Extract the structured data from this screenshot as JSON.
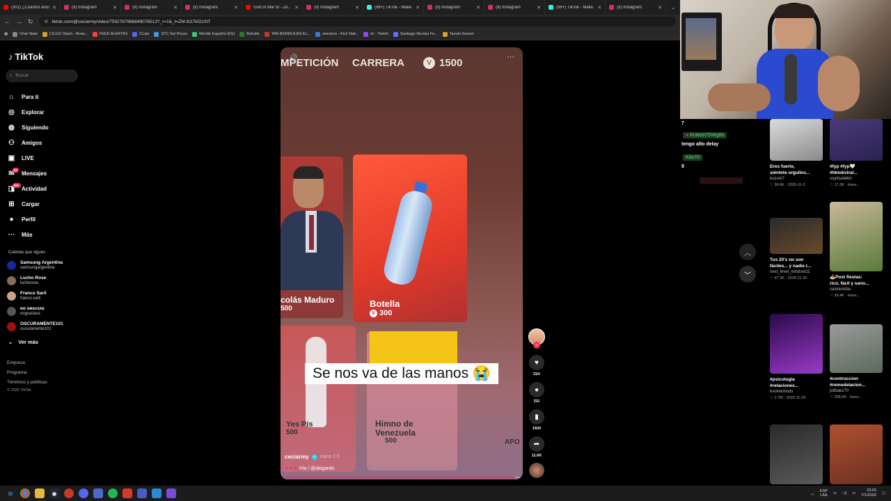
{
  "browser": {
    "tabs": [
      {
        "title": "(302) ¿Cuántos años...",
        "color": "#ff0000"
      },
      {
        "title": "(9) Instagram",
        "color": "#d62976"
      },
      {
        "title": "(9) Instagram",
        "color": "#d62976"
      },
      {
        "title": "(9) Instagram",
        "color": "#d62976"
      },
      {
        "title": "God of War III - Ze...",
        "color": "#ff0000"
      },
      {
        "title": "(9) Instagram",
        "color": "#d62976"
      },
      {
        "title": "(99+) TikTok - Make...",
        "color": "#25f4ee"
      },
      {
        "title": "(9) Instagram",
        "color": "#d62976"
      },
      {
        "title": "(9) Instagram",
        "color": "#d62976"
      },
      {
        "title": "(99+) TikTok - Make...",
        "color": "#25f4ee"
      },
      {
        "title": "(9) Instagram",
        "color": "#d62976"
      }
    ],
    "url": "tiktok.com/@ceciarmy/video/7592767966849076513?_r=1&_t=ZM-92t7kf2zXtT",
    "bookmarks": [
      "Chat Stats",
      "CS:GO Stash - Brow...",
      "FEED ALERTAS",
      "CLips",
      "STC Set Prices",
      "Wordle Español (ES)",
      "Boludle",
      "TAN BIONICA EN EL...",
      "sionaron - Kick Stat...",
      "trr - Twitch",
      "Santiago Nicolas Fe...",
      "Tanuki Sunset"
    ]
  },
  "sidebar": {
    "logo": "TikTok",
    "search_placeholder": "Buscar",
    "items": [
      {
        "label": "Para ti",
        "icon": "home-icon",
        "glyph": "⌂"
      },
      {
        "label": "Explorar",
        "icon": "compass-icon",
        "glyph": "◎"
      },
      {
        "label": "Siguiendo",
        "icon": "following-icon",
        "glyph": "◍"
      },
      {
        "label": "Amigos",
        "icon": "friends-icon",
        "glyph": "⚇"
      },
      {
        "label": "LIVE",
        "icon": "live-icon",
        "glyph": "▣"
      },
      {
        "label": "Mensajes",
        "icon": "messages-icon",
        "glyph": "✉",
        "badge": "57"
      },
      {
        "label": "Actividad",
        "icon": "activity-icon",
        "glyph": "◨",
        "badge": "99+"
      },
      {
        "label": "Cargar",
        "icon": "upload-icon",
        "glyph": "⊞"
      },
      {
        "label": "Perfil",
        "icon": "profile-icon",
        "glyph": "●"
      },
      {
        "label": "Más",
        "icon": "more-icon",
        "glyph": "···"
      }
    ],
    "following_header": "Cuentas que sigues",
    "following": [
      {
        "name": "Samsung Argentina",
        "user": "samsungargentina",
        "color": "#1428a0"
      },
      {
        "name": "Lucho Rose",
        "user": "luchorose",
        "color": "#8a6a5a"
      },
      {
        "name": "Franco Sarli",
        "user": "franco.sarli",
        "color": "#c9a48b"
      },
      {
        "name": "ɴᴏ ɢʀᴀᴄɪᴀꜱ",
        "user": "nograciasz",
        "color": "#555"
      },
      {
        "name": "OSCURAMENTE101",
        "user": "oscuramente101",
        "color": "#a01010"
      }
    ],
    "see_more": "Ver más",
    "footer": [
      "Empresa",
      "Programa",
      "Términos y políticas"
    ],
    "copyright": "© 2026 TikTok"
  },
  "video": {
    "top_labels": [
      "MPETICIÓN",
      "CARRERA",
      "1500"
    ],
    "cards": [
      {
        "title": "colás Maduro",
        "price": "500"
      },
      {
        "title": "Botella",
        "price": "300"
      },
      {
        "title": "Yes Pis",
        "price": "500"
      },
      {
        "title": "Himno de Venezuela",
        "price": "500"
      },
      {
        "title": "APO"
      }
    ],
    "subtitle": "Se nos va de las manos 😭",
    "author": "ceciarmy",
    "time": "Hace 2 h",
    "sound": "Vía / @daigardo",
    "progress": 0.98
  },
  "actions": {
    "likes": "31K",
    "comments": "311",
    "saves": "1920",
    "shares": "11.6K"
  },
  "chat": {
    "lines": [
      {
        "text": "7"
      },
      {
        "tag": "KratosVSVegito"
      },
      {
        "text": "tengo alto delay"
      },
      {
        "tag": "Kito70"
      },
      {
        "text": "8"
      }
    ]
  },
  "grid": [
    {
      "title1": "Eres fuerte,",
      "title2": "siéntete orgullos...",
      "user": "kuzum7",
      "meta": "♡ 39.6K · 2025-11-3",
      "colors": [
        "#dcdcdc",
        "#8a8a8a"
      ]
    },
    {
      "title1": "#fyp #fyp🤍",
      "title2": "#tiktokviral...",
      "user": "soylizadebri",
      "meta": "♡ 17.3K · Hace...",
      "colors": [
        "#4a3a7a",
        "#2a2250"
      ]
    },
    {
      "title1": "Tus 20's no son",
      "title2": "fáciles... y nadie t...",
      "user": "next_level_mindset11",
      "meta": "♡ 47.2K · 2025-11-20",
      "colors": [
        "#2a2a2a",
        "#6a4a2a"
      ]
    },
    {
      "title1": "🍝Post fiestas:",
      "title2": "rico, fácil y sano...",
      "user": "casirecetas",
      "meta": "♡ 26.4K · Hace...",
      "colors": [
        "#c8b89a",
        "#5a7a3a"
      ]
    },
    {
      "title1": "#psicologia",
      "title2": "#relaciones...",
      "user": "evolveminds",
      "meta": "♡ 1.7M · 2025-11-29",
      "colors": [
        "#2a0a4a",
        "#9a3ac8"
      ]
    },
    {
      "title1": "#contruccion",
      "title2": "#remodelacion...",
      "user": "julibaez70",
      "meta": "♡ 208.6K · Hace...",
      "colors": [
        "#9a9a9a",
        "#5a6a5a"
      ]
    },
    {
      "title1": "",
      "title2": "",
      "user": "",
      "meta": "",
      "colors": [
        "#2a2a2a",
        "#5a5a5a"
      ]
    },
    {
      "title1": "",
      "title2": "",
      "user": "",
      "meta": "",
      "colors": [
        "#b05030",
        "#6a3020"
      ]
    }
  ],
  "taskbar": {
    "lang": "ESP\nLAA",
    "time": "23:03",
    "date": "7/1/2026"
  }
}
